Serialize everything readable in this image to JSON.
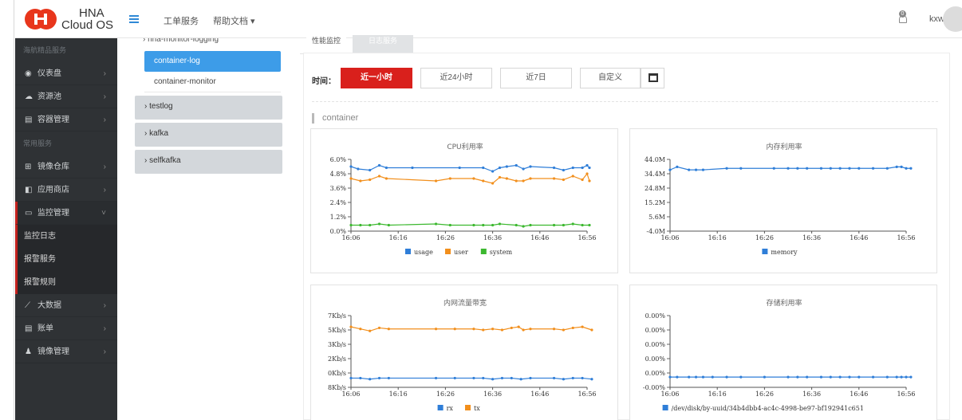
{
  "header": {
    "logo_line1": "HNA",
    "logo_line2": "Cloud OS",
    "nav": [
      "工单服务",
      "帮助文档 ▾"
    ],
    "notification_count": "0",
    "user": "kxw"
  },
  "sidebar": {
    "section1": "海航精品服务",
    "items1": [
      {
        "icon": "dashboard-icon",
        "glyph": "◉",
        "label": "仪表盘"
      },
      {
        "icon": "cloud-icon",
        "glyph": "☁",
        "label": "资源池"
      },
      {
        "icon": "container-icon",
        "glyph": "▤",
        "label": "容器管理"
      }
    ],
    "section2": "常用服务",
    "items2": [
      {
        "icon": "image-repo-icon",
        "glyph": "⊞",
        "label": "镜像仓库"
      },
      {
        "icon": "app-store-icon",
        "glyph": "◧",
        "label": "应用商店"
      },
      {
        "icon": "monitor-icon",
        "glyph": "▭",
        "label": "监控管理"
      }
    ],
    "sub_items": [
      "监控日志",
      "报警服务",
      "报警规则"
    ],
    "items3": [
      {
        "icon": "bigdata-icon",
        "glyph": "⟋",
        "label": "大数据"
      },
      {
        "icon": "bill-icon",
        "glyph": "▤",
        "label": "账单"
      },
      {
        "icon": "image-mgmt-icon",
        "glyph": "♟",
        "label": "镜像管理"
      }
    ]
  },
  "tree": {
    "top": "› hna-monitor-logging",
    "selected": "container-log",
    "leaf": "container-monitor",
    "groups": [
      "› testlog",
      "› kafka",
      "› selfkafka"
    ]
  },
  "tabs": [
    "性能监控",
    "日志服务"
  ],
  "time": {
    "label": "时间：",
    "buttons": [
      "近一小时",
      "近24小时",
      "近7日",
      "自定义"
    ]
  },
  "section_title": "container",
  "colors": {
    "blue": "#2f7ed8",
    "orange": "#f28f1c",
    "green": "#3cb82f",
    "accent": "#d9201c"
  },
  "chart_data": [
    {
      "type": "line",
      "title": "CPU利用率",
      "x": [
        "16:06",
        "16:16",
        "16:26",
        "16:36",
        "16:46",
        "16:56"
      ],
      "ylim": [
        0,
        6.0
      ],
      "yticks": [
        "6.0%",
        "4.8%",
        "3.6%",
        "2.4%",
        "1.2%",
        "0.0%"
      ],
      "series": [
        {
          "name": "usage",
          "color": "#2f7ed8",
          "points": [
            [
              0,
              5.4
            ],
            [
              1.5,
              5.2
            ],
            [
              4,
              5.1
            ],
            [
              6,
              5.5
            ],
            [
              7.5,
              5.3
            ],
            [
              13,
              5.3
            ],
            [
              23,
              5.3
            ],
            [
              28,
              5.3
            ],
            [
              30,
              5.0
            ],
            [
              31.5,
              5.3
            ],
            [
              33,
              5.4
            ],
            [
              35,
              5.5
            ],
            [
              36.5,
              5.2
            ],
            [
              38,
              5.4
            ],
            [
              43,
              5.3
            ],
            [
              45,
              5.1
            ],
            [
              47,
              5.3
            ],
            [
              49,
              5.3
            ],
            [
              50,
              5.5
            ],
            [
              50.5,
              5.3
            ]
          ]
        },
        {
          "name": "user",
          "color": "#f28f1c",
          "points": [
            [
              0,
              4.4
            ],
            [
              2,
              4.2
            ],
            [
              4,
              4.3
            ],
            [
              6,
              4.6
            ],
            [
              7.5,
              4.4
            ],
            [
              18,
              4.2
            ],
            [
              21,
              4.4
            ],
            [
              26,
              4.4
            ],
            [
              28,
              4.2
            ],
            [
              30,
              4.0
            ],
            [
              31.5,
              4.5
            ],
            [
              33,
              4.4
            ],
            [
              35,
              4.2
            ],
            [
              36.5,
              4.2
            ],
            [
              38,
              4.4
            ],
            [
              43,
              4.4
            ],
            [
              45,
              4.3
            ],
            [
              47,
              4.6
            ],
            [
              49,
              4.3
            ],
            [
              50,
              4.8
            ],
            [
              50.5,
              4.2
            ]
          ]
        },
        {
          "name": "system",
          "color": "#3cb82f",
          "points": [
            [
              0,
              0.5
            ],
            [
              2,
              0.5
            ],
            [
              4,
              0.5
            ],
            [
              6,
              0.6
            ],
            [
              8,
              0.5
            ],
            [
              18,
              0.6
            ],
            [
              21,
              0.5
            ],
            [
              26,
              0.5
            ],
            [
              28,
              0.5
            ],
            [
              30,
              0.5
            ],
            [
              31.5,
              0.6
            ],
            [
              35,
              0.5
            ],
            [
              36.5,
              0.4
            ],
            [
              38,
              0.5
            ],
            [
              43,
              0.5
            ],
            [
              45,
              0.5
            ],
            [
              47,
              0.6
            ],
            [
              49,
              0.5
            ],
            [
              50.5,
              0.5
            ]
          ]
        }
      ]
    },
    {
      "type": "line",
      "title": "内存利用率",
      "x": [
        "16:06",
        "16:16",
        "16:26",
        "16:36",
        "16:46",
        "16:56"
      ],
      "ylim": [
        -4.0,
        44.0
      ],
      "yticks": [
        "44.0M",
        "34.4M",
        "24.8M",
        "15.2M",
        "5.6M",
        "-4.0M"
      ],
      "series": [
        {
          "name": "memory",
          "color": "#2f7ed8",
          "points": [
            [
              0,
              37
            ],
            [
              1.5,
              39
            ],
            [
              4,
              37
            ],
            [
              5.5,
              37
            ],
            [
              7,
              37
            ],
            [
              12,
              38
            ],
            [
              15,
              38
            ],
            [
              22,
              38
            ],
            [
              25,
              38
            ],
            [
              27,
              38
            ],
            [
              29,
              38
            ],
            [
              32,
              38
            ],
            [
              34,
              38
            ],
            [
              36,
              38
            ],
            [
              38,
              38
            ],
            [
              40,
              38
            ],
            [
              43,
              38
            ],
            [
              46,
              38
            ],
            [
              48,
              39
            ],
            [
              49,
              39
            ],
            [
              50,
              38
            ],
            [
              51,
              38
            ]
          ]
        }
      ]
    },
    {
      "type": "line",
      "title": "内网流量带宽",
      "x": [
        "16:06",
        "16:16",
        "16:26",
        "16:36",
        "16:46",
        "16:56"
      ],
      "yticks": [
        "7Kb/s",
        "5Kb/s",
        "3Kb/s",
        "2Kb/s",
        "0Kb/s",
        "8Kb/s"
      ],
      "series": [
        {
          "name": "rx",
          "color": "#2f7ed8",
          "points": [
            [
              0,
              0.9
            ],
            [
              2,
              0.9
            ],
            [
              4,
              0.8
            ],
            [
              6,
              0.9
            ],
            [
              8,
              0.9
            ],
            [
              18,
              0.9
            ],
            [
              22,
              0.9
            ],
            [
              26,
              0.9
            ],
            [
              28,
              0.9
            ],
            [
              30,
              0.8
            ],
            [
              32,
              0.9
            ],
            [
              34,
              0.9
            ],
            [
              36,
              0.8
            ],
            [
              38,
              0.9
            ],
            [
              43,
              0.9
            ],
            [
              45,
              0.8
            ],
            [
              47,
              0.9
            ],
            [
              49,
              0.9
            ],
            [
              51,
              0.8
            ]
          ]
        },
        {
          "name": "tx",
          "color": "#f28f1c",
          "points": [
            [
              0,
              5.9
            ],
            [
              2,
              5.7
            ],
            [
              4,
              5.5
            ],
            [
              6,
              5.8
            ],
            [
              8,
              5.7
            ],
            [
              18,
              5.7
            ],
            [
              22,
              5.7
            ],
            [
              26,
              5.7
            ],
            [
              28,
              5.6
            ],
            [
              30,
              5.7
            ],
            [
              32,
              5.6
            ],
            [
              34,
              5.8
            ],
            [
              35.5,
              5.9
            ],
            [
              36.5,
              5.6
            ],
            [
              38,
              5.7
            ],
            [
              43,
              5.7
            ],
            [
              45,
              5.6
            ],
            [
              47,
              5.8
            ],
            [
              49,
              5.9
            ],
            [
              51,
              5.6
            ]
          ]
        }
      ]
    },
    {
      "type": "line",
      "title": "存储利用率",
      "x": [
        "16:06",
        "16:16",
        "16:26",
        "16:36",
        "16:46",
        "16:56"
      ],
      "yticks": [
        "0.00%",
        "0.00%",
        "0.00%",
        "0.00%",
        "0.00%",
        "-0.00%"
      ],
      "series": [
        {
          "name": "/dev/disk/by-uuid/34b4dbb4-ac4c-4998-be97-bf192941c651",
          "color": "#2f7ed8",
          "points": [
            [
              0,
              1
            ],
            [
              1.5,
              1
            ],
            [
              4,
              1
            ],
            [
              5.5,
              1
            ],
            [
              7,
              1
            ],
            [
              9,
              1
            ],
            [
              12,
              1
            ],
            [
              15,
              1
            ],
            [
              20,
              1
            ],
            [
              25,
              1
            ],
            [
              27,
              1
            ],
            [
              29,
              1
            ],
            [
              32,
              1
            ],
            [
              34,
              1
            ],
            [
              36,
              1
            ],
            [
              38,
              1
            ],
            [
              40,
              1
            ],
            [
              43,
              1
            ],
            [
              46,
              1
            ],
            [
              48,
              1
            ],
            [
              49,
              1
            ],
            [
              50,
              1
            ],
            [
              51,
              1
            ]
          ]
        }
      ]
    }
  ]
}
